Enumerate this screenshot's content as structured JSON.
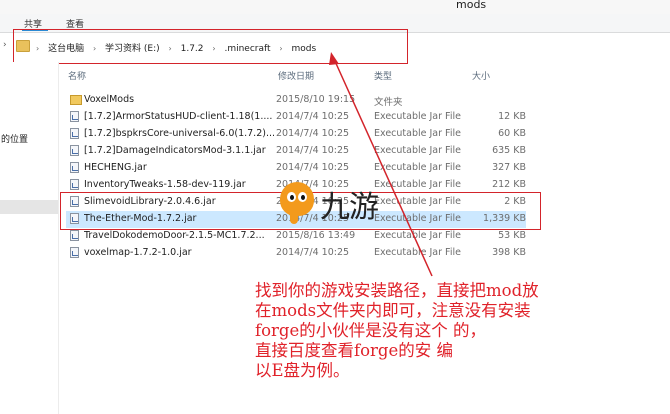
{
  "window": {
    "title": "mods"
  },
  "ribbon": {
    "tab_share": "共享",
    "tab_view": "查看"
  },
  "breadcrumb": [
    "这台电脑",
    "学习资料 (E:)",
    "1.7.2",
    ".minecraft",
    "mods"
  ],
  "sidebar": {
    "location_text": "的位置"
  },
  "columns": {
    "name": "名称",
    "date": "修改日期",
    "type": "类型",
    "size": "大小"
  },
  "files": [
    {
      "name": "VoxelMods",
      "date": "2015/8/10 19:15",
      "type": "文件夹",
      "size": "",
      "icon": "folder-icon"
    },
    {
      "name": "[1.7.2]ArmorStatusHUD-client-1.18(1....",
      "date": "2014/7/4 10:25",
      "type": "Executable Jar File",
      "size": "12 KB",
      "icon": "jar-file-icon"
    },
    {
      "name": "[1.7.2]bspkrsCore-universal-6.0(1.7.2)...",
      "date": "2014/7/4 10:25",
      "type": "Executable Jar File",
      "size": "60 KB",
      "icon": "jar-file-icon"
    },
    {
      "name": "[1.7.2]DamageIndicatorsMod-3.1.1.jar",
      "date": "2014/7/4 10:25",
      "type": "Executable Jar File",
      "size": "635 KB",
      "icon": "jar-file-icon"
    },
    {
      "name": "HECHENG.jar",
      "date": "2014/7/4 10:25",
      "type": "Executable Jar File",
      "size": "327 KB",
      "icon": "jar-file-icon"
    },
    {
      "name": "InventoryTweaks-1.58-dev-119.jar",
      "date": "2014/7/4 10:25",
      "type": "Executable Jar File",
      "size": "212 KB",
      "icon": "jar-file-icon"
    },
    {
      "name": "SlimevoidLibrary-2.0.4.6.jar",
      "date": "2014/7/4 10:25",
      "type": "Executable Jar File",
      "size": "2 KB",
      "icon": "jar-file-icon"
    },
    {
      "name": "The-Ether-Mod-1.7.2.jar",
      "date": "2014/7/4 10:25",
      "type": "Executable Jar File",
      "size": "1,339 KB",
      "icon": "jar-file-icon",
      "selected": true
    },
    {
      "name": "TravelDokodemoDoor-2.1.5-MC1.7.2...",
      "date": "2015/8/16 13:49",
      "type": "Executable Jar File",
      "size": "53 KB",
      "icon": "jar-file-icon"
    },
    {
      "name": "voxelmap-1.7.2-1.0.jar",
      "date": "2014/7/4 10:25",
      "type": "Executable Jar File",
      "size": "398 KB",
      "icon": "jar-file-icon"
    }
  ],
  "watermark": {
    "brand": "九游"
  },
  "annotation": {
    "text": "找到你的游戏安装路径，直接把mod放\n在mods文件夹内即可，注意没有安装\nforge的小伙伴是没有这个 的，\n直接百度查看forge的安 编\n以E盘为例。"
  },
  "colors": {
    "highlight_red": "#d3242b",
    "annotation_red": "#e0222a",
    "selection_blue": "#cce8ff"
  }
}
